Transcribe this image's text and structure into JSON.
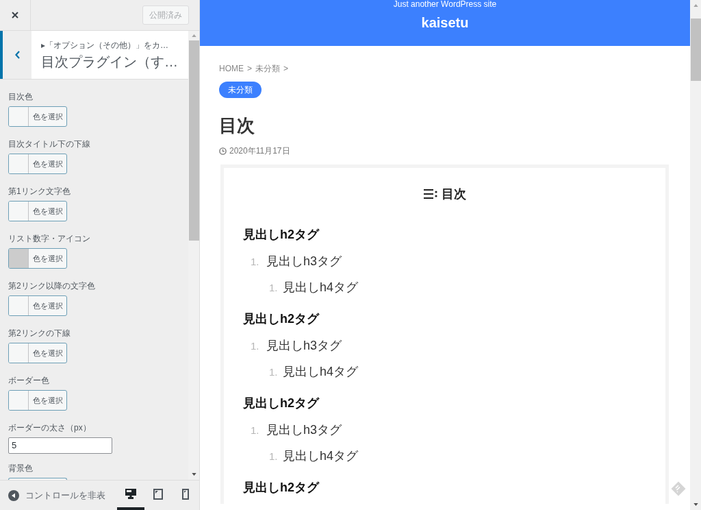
{
  "customizer": {
    "publish_button": "公開済み",
    "section": {
      "breadcrumb": "▸「オプション（その他）」をカ…",
      "title": "目次プラグイン（す…"
    },
    "controls": [
      {
        "kind": "color",
        "label": "目次色",
        "button": "色を選択"
      },
      {
        "kind": "color",
        "label": "目次タイトル下の下線",
        "button": "色を選択"
      },
      {
        "kind": "color",
        "label": "第1リンク文字色",
        "button": "色を選択"
      },
      {
        "kind": "color",
        "label": "リスト数字・アイコン",
        "button": "色を選択",
        "color": "#cccccc"
      },
      {
        "kind": "color",
        "label": "第2リンク以降の文字色",
        "button": "色を選択"
      },
      {
        "kind": "color",
        "label": "第2リンクの下線",
        "button": "色を選択"
      },
      {
        "kind": "color",
        "label": "ボーダー色",
        "button": "色を選択"
      },
      {
        "kind": "number",
        "label": "ボーダーの太さ（px）",
        "value": "5"
      },
      {
        "kind": "color",
        "label": "背景色"
      }
    ],
    "footer": {
      "hide_controls": "コントロールを非表",
      "devices": [
        {
          "kind": "desktop",
          "selected": true
        },
        {
          "kind": "tablet",
          "selected": false
        },
        {
          "kind": "mobile",
          "selected": false
        }
      ]
    }
  },
  "preview": {
    "site": {
      "tagline": "Just another WordPress site",
      "title": "kaisetu"
    },
    "breadcrumb": [
      {
        "label": "HOME",
        "separator": ">"
      },
      {
        "label": "未分類",
        "separator": ">"
      }
    ],
    "category": "未分類",
    "title": "目次",
    "date": "2020年11月17日",
    "toc": {
      "title": "目次",
      "items": [
        {
          "text": "見出しh2タグ",
          "children": [
            {
              "marker": "1.",
              "text": "見出しh3タグ",
              "children": [
                {
                  "marker": "1.",
                  "text": "見出しh4タグ"
                }
              ]
            }
          ]
        },
        {
          "text": "見出しh2タグ",
          "children": [
            {
              "marker": "1.",
              "text": "見出しh3タグ",
              "children": [
                {
                  "marker": "1.",
                  "text": "見出しh4タグ"
                }
              ]
            }
          ]
        },
        {
          "text": "見出しh2タグ",
          "children": [
            {
              "marker": "1.",
              "text": "見出しh3タグ",
              "children": [
                {
                  "marker": "1.",
                  "text": "見出しh4タグ"
                }
              ]
            }
          ]
        },
        {
          "text": "見出しh2タグ"
        }
      ]
    }
  }
}
